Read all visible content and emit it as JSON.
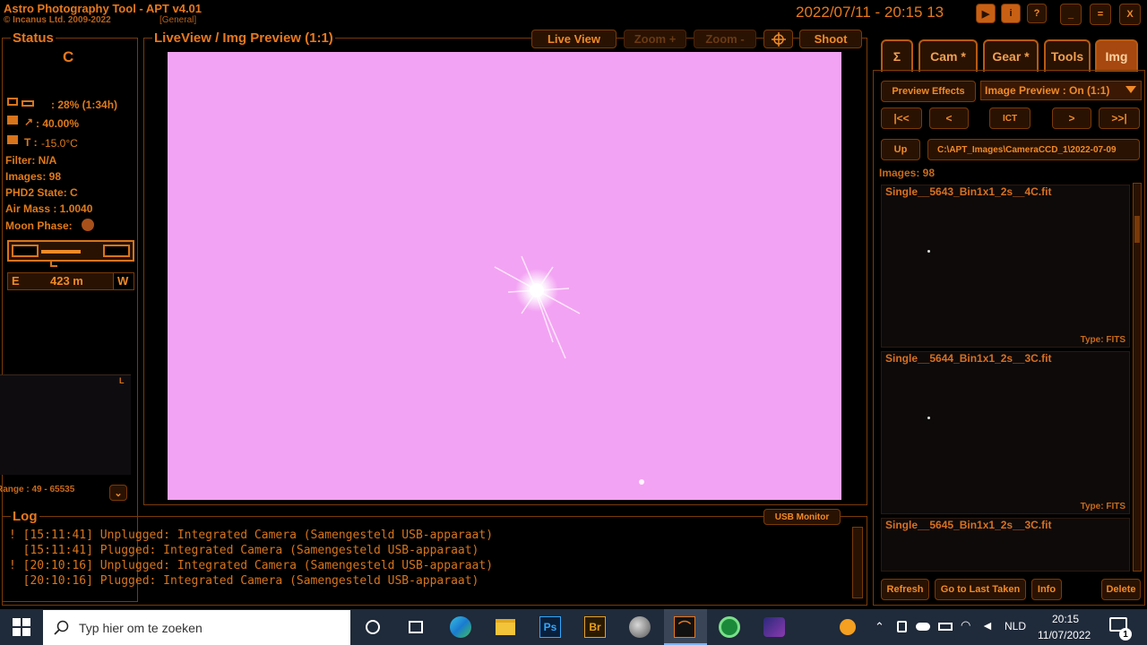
{
  "app": {
    "title": "Astro Photography Tool  -  APT v4.01",
    "copyright": "© Incanus Ltd. 2009-2022",
    "profile": "[General]",
    "datetime": "2022/07/11 - 20:15 13"
  },
  "title_buttons": {
    "minimize": "_",
    "restore": "=",
    "close": "X",
    "info": "i",
    "help": "?"
  },
  "status": {
    "title": "Status",
    "state": "C",
    "battery": ": 28% (1:34h)",
    "humidity": ": 40.00%",
    "temp_label": "T :",
    "temp": "-15.0°C",
    "filter": "Filter: N/A",
    "images": "Images: 98",
    "phd2": "PHD2 State: C",
    "airmass": "Air Mass : 1.0040",
    "moon": "Moon Phase:",
    "direction_e": "E",
    "altitude": "423 m",
    "direction_w": "W",
    "histogram_corner": "L",
    "range": "Range : 49 - 65535"
  },
  "liveview": {
    "title": "LiveView / Img Preview (1:1)",
    "live_view_btn": "Live View",
    "zoom_in_btn": "Zoom +",
    "zoom_out_btn": "Zoom -",
    "shoot_btn": "Shoot"
  },
  "tabs": [
    {
      "label": "Σ"
    },
    {
      "label": "Cam *"
    },
    {
      "label": "Gear *"
    },
    {
      "label": "Tools"
    },
    {
      "label": "Img"
    }
  ],
  "img_panel": {
    "preview_effects": "Preview Effects",
    "preview_select": "Image Preview : On (1:1)",
    "nav_first": "|<<",
    "nav_prev": "<",
    "nav_ict": "ICT",
    "nav_next": ">",
    "nav_last": ">>|",
    "up_btn": "Up",
    "path": "C:\\APT_Images\\CameraCCD_1\\2022-07-09",
    "images_count": "Images: 98",
    "files": [
      {
        "name": "Single__5643_Bin1x1_2s__4C.fit",
        "type": "Type: FITS"
      },
      {
        "name": "Single__5644_Bin1x1_2s__3C.fit",
        "type": "Type: FITS"
      },
      {
        "name": "Single__5645_Bin1x1_2s__3C.fit",
        "type": ""
      }
    ],
    "refresh": "Refresh",
    "goto_last": "Go to Last Taken",
    "info": "Info",
    "delete": "Delete"
  },
  "log": {
    "title": "Log",
    "usb_monitor": "USB Monitor",
    "lines": [
      "! [15:11:41] Unplugged: Integrated Camera (Samengesteld USB-apparaat)",
      "  [15:11:41] Plugged: Integrated Camera (Samengesteld USB-apparaat)",
      "! [20:10:16] Unplugged: Integrated Camera (Samengesteld USB-apparaat)",
      "  [20:10:16] Plugged: Integrated Camera (Samengesteld USB-apparaat)"
    ]
  },
  "taskbar": {
    "search_placeholder": "Typ hier om te zoeken",
    "ps": "Ps",
    "br": "Br",
    "lang": "NLD",
    "time": "20:15",
    "date": "11/07/2022",
    "notifications": "1"
  },
  "colors": {
    "accent": "#e8781c",
    "preview_bg": "#f3a3f3",
    "tab_active": "#a64810"
  }
}
